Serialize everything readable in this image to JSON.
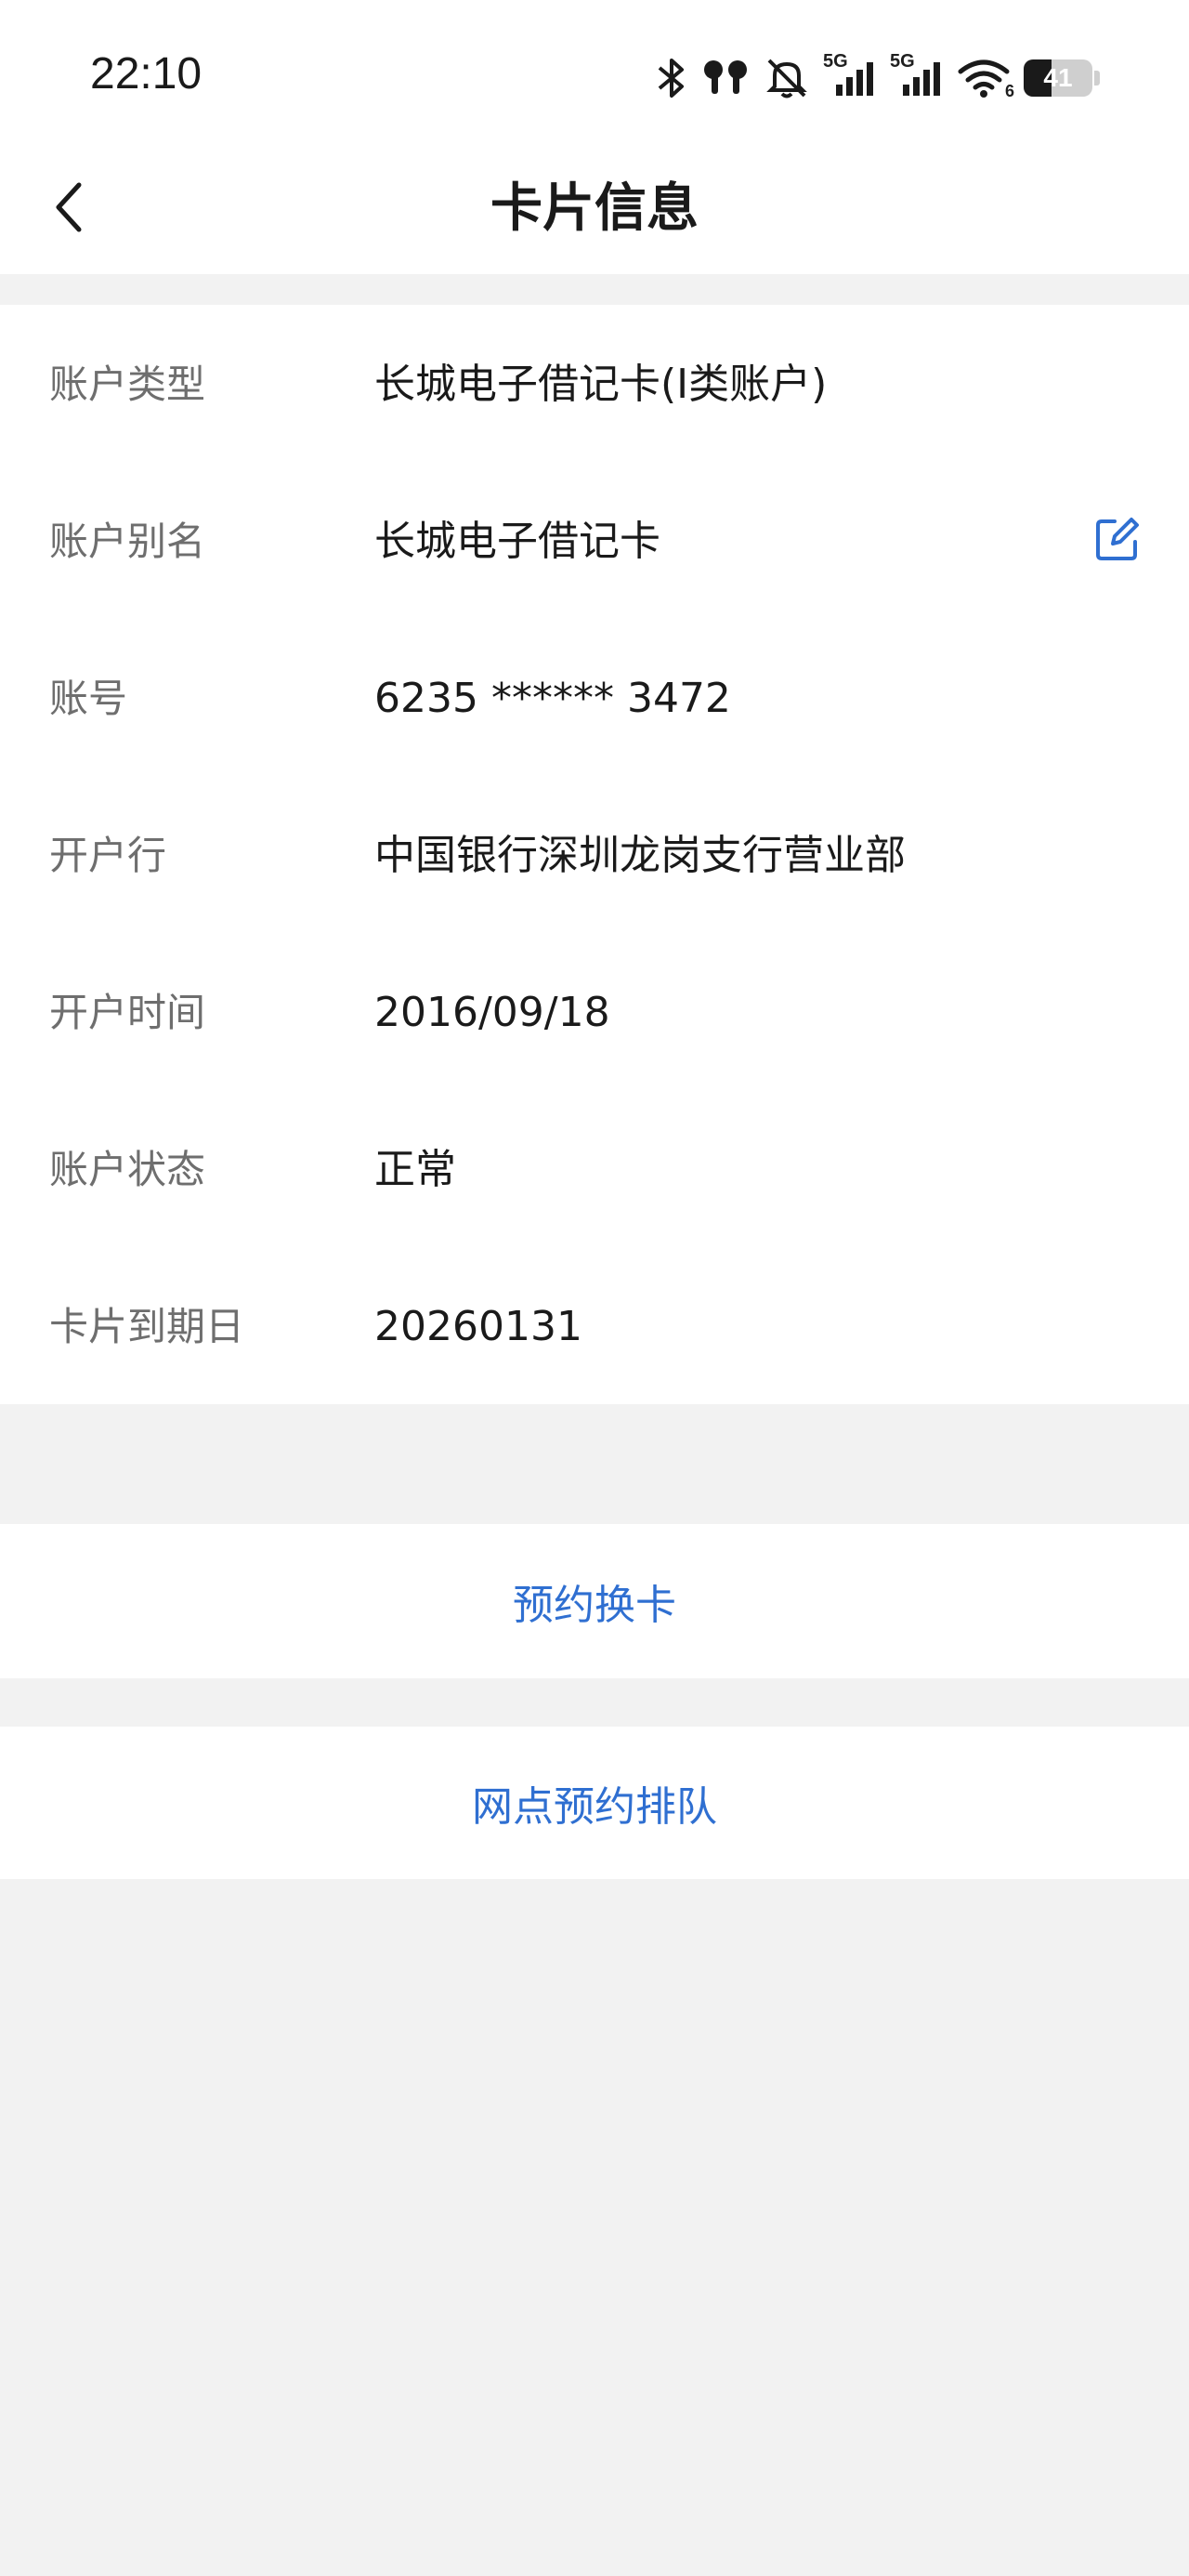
{
  "status_bar": {
    "time": "22:10",
    "icons": [
      "bluetooth-icon",
      "earbuds-icon",
      "mute-icon",
      "signal-5g-icon",
      "signal-5g-icon",
      "wifi-icon",
      "battery-icon"
    ],
    "network_label_1": "5G",
    "network_label_2": "5G",
    "wifi_label": "6",
    "battery_level": 41,
    "battery_text": "41"
  },
  "header": {
    "back_icon": "chevron-left-icon",
    "title": "卡片信息"
  },
  "card_info": {
    "rows": [
      {
        "label": "账户类型",
        "value": "长城电子借记卡(I类账户)"
      },
      {
        "label": "账户别名",
        "value": "长城电子借记卡",
        "edit_icon": "edit-icon"
      },
      {
        "label": "账号",
        "value": "6235 ****** 3472"
      },
      {
        "label": "开户行",
        "value": "中国银行深圳龙岗支行营业部"
      },
      {
        "label": "开户时间",
        "value": "2016/09/18"
      },
      {
        "label": "账户状态",
        "value": "正常"
      },
      {
        "label": "卡片到期日",
        "value": "20260131"
      }
    ]
  },
  "actions": {
    "reserve_card_replacement": "预约换卡",
    "branch_queue_reservation": "网点预约排队"
  },
  "colors": {
    "accent": "#2f6fd1",
    "background": "#f2f2f2",
    "card": "#ffffff",
    "label": "#6e6e6e",
    "text": "#1a1a1a"
  }
}
